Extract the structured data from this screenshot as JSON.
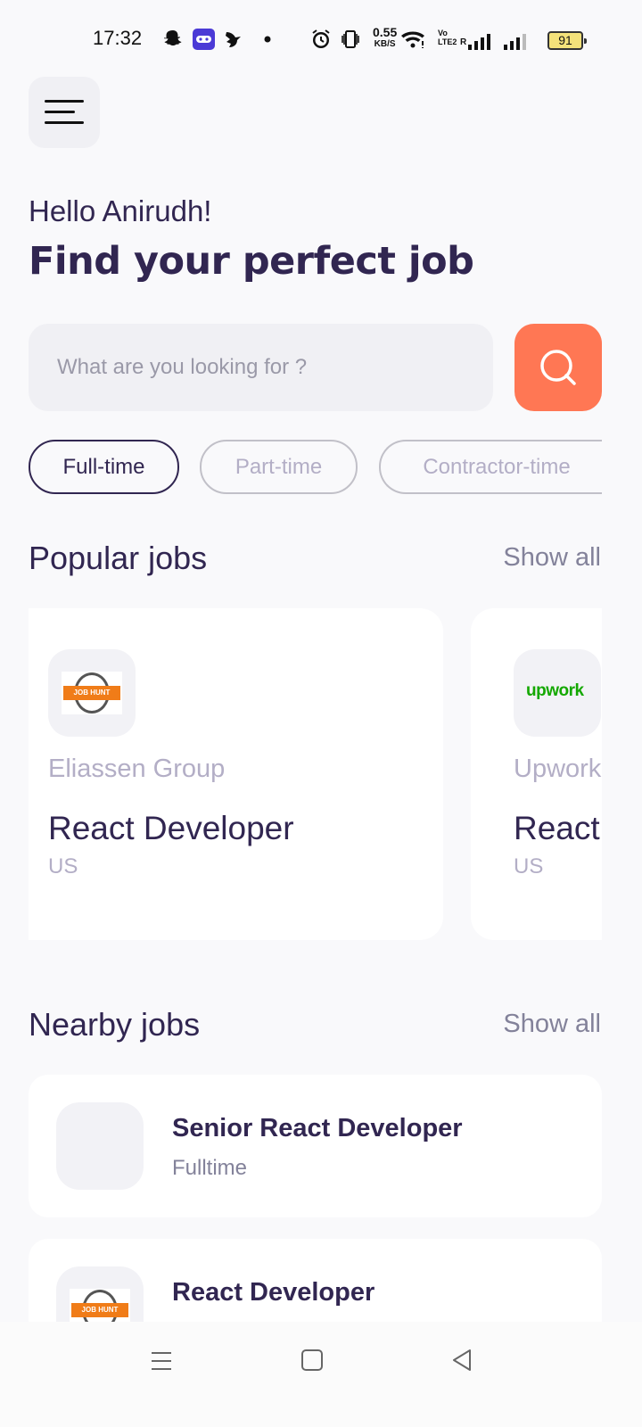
{
  "status_bar": {
    "time": "17:32",
    "net_speed_value": "0.55",
    "net_speed_unit": "KB/S",
    "volte_top": "Vo",
    "volte_bottom": "LTE2",
    "roaming": "R",
    "battery": "91",
    "icons": [
      "snapchat-icon",
      "game-icon",
      "bird-icon",
      "dot-icon",
      "alarm-icon",
      "vibrate-icon",
      "wifi-icon",
      "signal-icon",
      "signal-icon",
      "battery-icon"
    ]
  },
  "header": {
    "menu_icon": "menu-icon",
    "greeting": "Hello Anirudh!",
    "headline": "Find your perfect job"
  },
  "search": {
    "placeholder": "What are you looking for ?",
    "value": "",
    "button_icon": "search-icon"
  },
  "job_types": [
    {
      "label": "Full-time",
      "active": true
    },
    {
      "label": "Part-time",
      "active": false
    },
    {
      "label": "Contractor-time",
      "active": false
    }
  ],
  "popular": {
    "title": "Popular jobs",
    "show_all": "Show all",
    "jobs": [
      {
        "company": "Eliassen Group",
        "title": "React Developer",
        "location": "US",
        "logo_text": "JOB HUNT"
      },
      {
        "company": "Upwork",
        "title": "React",
        "location": "US",
        "logo_text": "upwork"
      }
    ]
  },
  "nearby": {
    "title": "Nearby jobs",
    "show_all": "Show all",
    "jobs": [
      {
        "title": "Senior React Developer",
        "type": "Fulltime"
      },
      {
        "title": "React Developer",
        "type": "",
        "logo_text": "JOB HUNT"
      }
    ]
  },
  "colors": {
    "primary": "#312651",
    "accent": "#ff7754",
    "gray": "#83829a",
    "light_gray": "#b3aec6",
    "background": "#f9f9fb"
  }
}
